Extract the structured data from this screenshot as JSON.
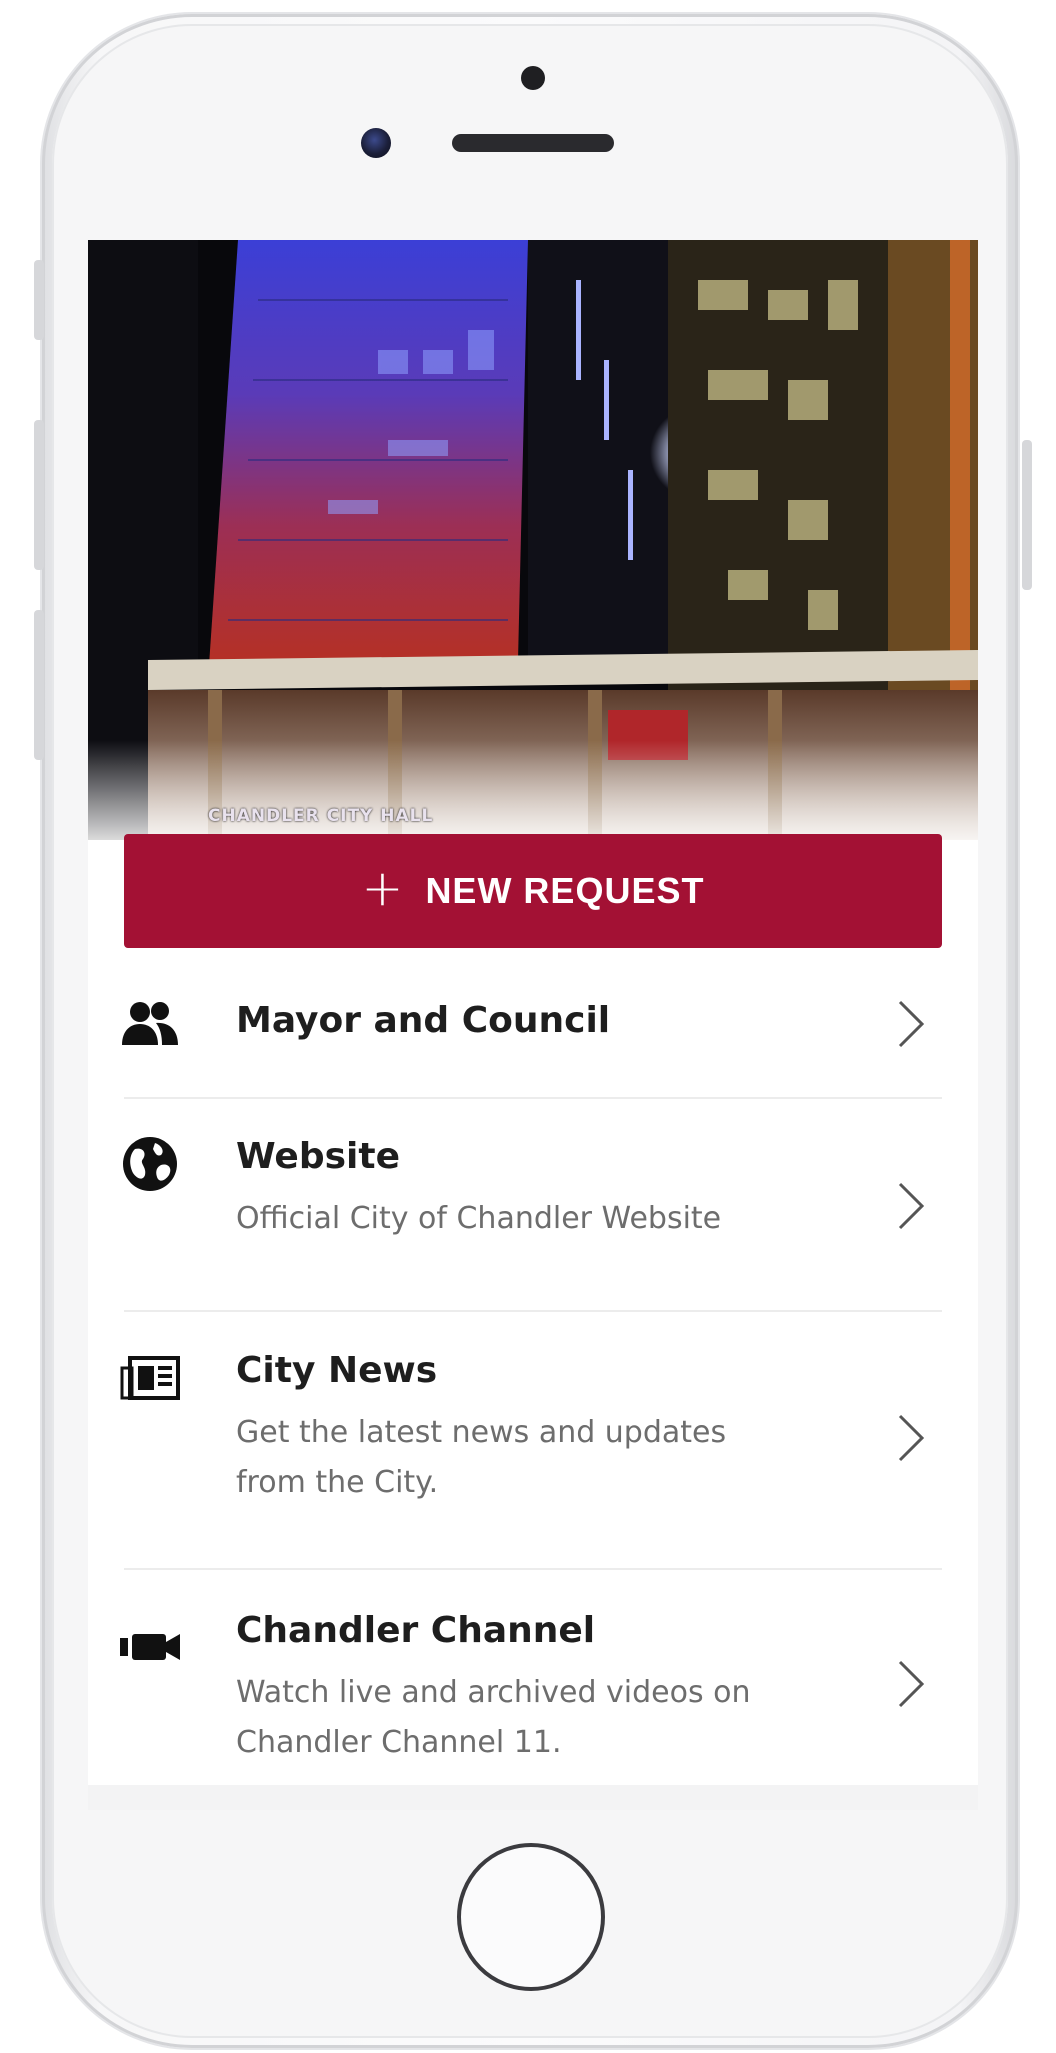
{
  "hero": {
    "caption": "CHANDLER CITY HALL",
    "image_description_icon": "city-hall-photo"
  },
  "new_request": {
    "plus_icon": "+",
    "label": "NEW REQUEST",
    "color": "#a31134"
  },
  "menu": {
    "items": [
      {
        "title": "Mayor and Council",
        "description": "",
        "icon": "people-icon"
      },
      {
        "title": "Website",
        "description": "Official City of Chandler Website",
        "icon": "globe-icon"
      },
      {
        "title": "City News",
        "description": "Get the latest news and updates from the City.",
        "icon": "newspaper-icon"
      },
      {
        "title": "Chandler Channel",
        "description": "Watch live and archived videos on Chandler Channel 11.",
        "icon": "video-camera-icon"
      }
    ]
  }
}
